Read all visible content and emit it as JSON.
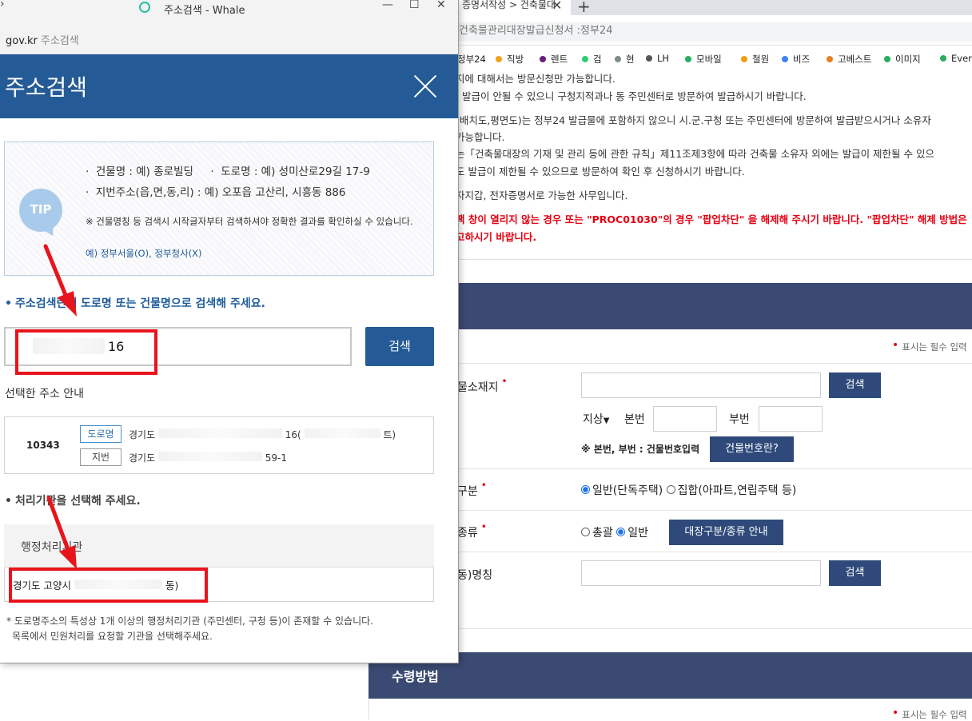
{
  "background": {
    "tab_label": "증명서작성 > 건축물대",
    "url_text": "건축물관리대장발급신청서 :정부24",
    "bookmarks": [
      {
        "label": "정부24",
        "color": ""
      },
      {
        "label": "직방",
        "color": "#f2a21b"
      },
      {
        "label": "렌트",
        "color": "#6b1f7a"
      },
      {
        "label": "검",
        "color": "#2ecc71"
      },
      {
        "label": "현",
        "color": "#7f8c8d"
      },
      {
        "label": "LH",
        "color": "#555555"
      },
      {
        "label": "모바일",
        "color": "#27ae60"
      },
      {
        "label": "철원",
        "color": "#f39c12"
      },
      {
        "label": "비즈",
        "color": "#3b82f6"
      },
      {
        "label": "고베스트",
        "color": "#e67e22"
      },
      {
        "label": "이미지",
        "color": "#27ae60"
      },
      {
        "label": "Ever",
        "color": "#27ae60"
      }
    ],
    "notices": [
      "지에 대해서는 방문신청만 가능합니다.",
      "· 발급이 안될 수 있으니 구청지적과나 동 주민센터로 방문하여 발급하시기 바랍니다.",
      "(배치도,평면도)는 정부24 발급물에 포함하지 않으니 시.군.구청 또는 주민센터에 방문하여 발급받으시거나 소유자",
      "가능합니다.",
      "는「건축물대장의 기재 및 관리 등에 관한 규칙」제11조제3항에 따라 건축물 소유자 외에는 발급이 제한될 수 있으",
      "도 발급이 제한될 수 있으므로 방문하여 확인 후 신청하시기 바랍니다.",
      "자지갑, 전자증명서로 가능한 사무입니다."
    ],
    "red_notice_1": "팩 창이 열리지 않는 경우 또는 \"PROC01030\"의 경우 \"팝업차단\" 을 해제해 주시기 바랍니다. \"팝업차단\" 해제 방법은",
    "red_notice_2": "고하시기 바랍니다.",
    "required_note": "표시는 필수 입력",
    "form": {
      "address_label": "물소재지",
      "search_button": "검색",
      "select_value": "지상",
      "main_no_label": "본번",
      "sub_no_label": "부번",
      "help_text": "※ 본번, 부번 : 건물번호입력",
      "building_no_button": "건물번호란?",
      "type_label": "구분",
      "type_options": [
        "일반(단독주택)",
        "집합(아파트,연립주택 등)"
      ],
      "kind_label": "종류",
      "kind_options": [
        "총괄",
        "일반"
      ],
      "kind_guide_button": "대장구분/종류 안내",
      "dong_label": "동)명칭",
      "dong_search_button": "검색"
    },
    "receive_title": "수령방법",
    "required_note_2": "표시는 필수 입력"
  },
  "popup": {
    "window_title": "주소검색 - Whale",
    "url_domain": "gov.kr",
    "url_page": "주소검색",
    "header_title": "주소검색",
    "tip_badge": "TIP",
    "tip_line1_a": "건물명 : 예) 종로빌딩",
    "tip_line1_b": "도로명 : 예) 성미산로29길 17-9",
    "tip_line2": "지번주소(읍,면,동,리) : 예) 오포읍 고산리, 시흥동 886",
    "tip_note": "※ 건물명칭 등 검색시 시작글자부터 검색하셔야 정확한 결과를 확인하실 수 있습니다.",
    "tip_example": "예) 정부서울(O), 정부청사(X)",
    "guide_search": "주소검색란에 도로명 또는 건물명으로 검색해 주세요.",
    "search_value": "16",
    "search_button": "검색",
    "selected_title": "선택한 주소 안내",
    "zip": "10343",
    "road_tag": "도로명",
    "road_addr_a": "경기도",
    "road_addr_b": "16(",
    "road_addr_c": "트)",
    "jibun_tag": "지번",
    "jibun_addr_a": "경기도",
    "jibun_addr_b": "59-1",
    "guide_org": "처리기관을 선택해 주세요.",
    "org_header": "행정처리기관",
    "org_value_a": "경기도 고양시",
    "org_value_b": "동)",
    "foot_note_1": "* 도로명주소의 특성상 1개 이상의 행정처리기관 (주민센터, 구청 등)이 존재할 수 있습니다.",
    "foot_note_2": "목록에서 민원처리를 요청할 기관을 선택해주세요."
  },
  "colors": {
    "popup_blue": "#245b97",
    "navy": "#3a4a72",
    "annotation_red": "#e8141c"
  }
}
